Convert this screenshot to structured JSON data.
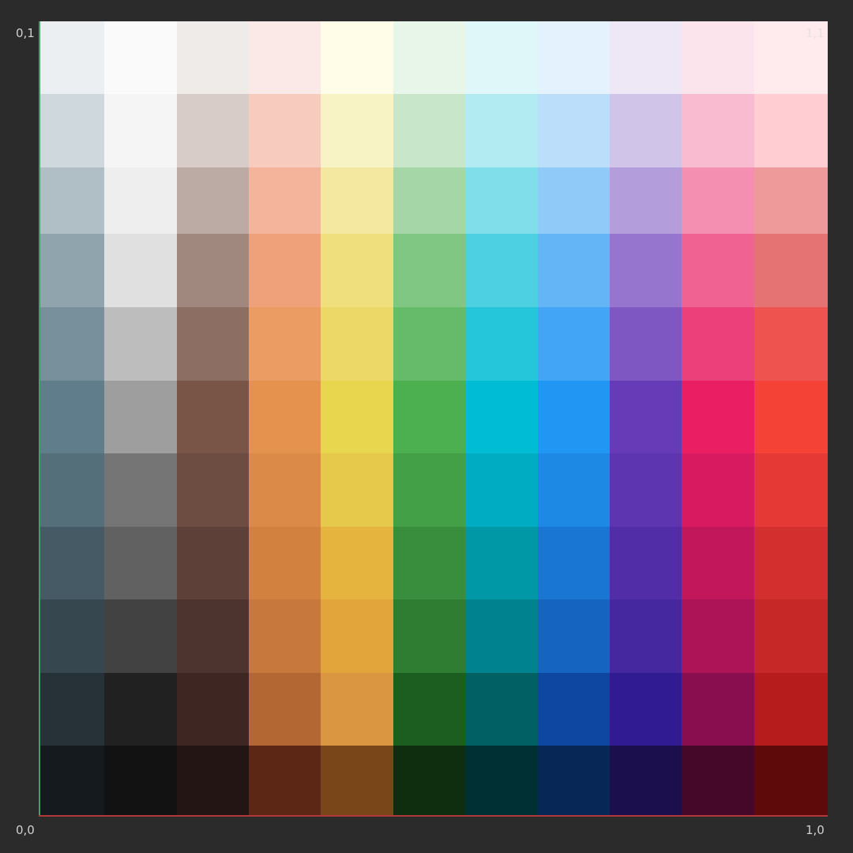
{
  "labels": {
    "top_left": "0,1",
    "top_right": "1,1",
    "bottom_left": "0,0",
    "bottom_right": "1,0"
  },
  "colors": {
    "background": "#2b2b2b",
    "axis_y": "#3fa06a",
    "axis_x": "#b03a3a"
  },
  "palette": [
    [
      "#eceff1",
      "#fafafa",
      "#efebe9",
      "#fbe9e7",
      "#fffde7",
      "#e8f5e9",
      "#e0f7fa",
      "#e3f2fd",
      "#ede7f6",
      "#fce4ec",
      "#ffebee"
    ],
    [
      "#cfd8dc",
      "#f5f5f5",
      "#d7ccc8",
      "#f8cbbf",
      "#f8f3c4",
      "#c8e6c9",
      "#b2ebf2",
      "#bbdefb",
      "#d1c4e9",
      "#f8bbd0",
      "#ffcdd2"
    ],
    [
      "#b0bec5",
      "#eeeeee",
      "#bcaaa4",
      "#f4b39b",
      "#f4e8a0",
      "#a5d6a7",
      "#80deea",
      "#90caf9",
      "#b39ddb",
      "#f48fb1",
      "#ef9a9a"
    ],
    [
      "#90a4ae",
      "#e0e0e0",
      "#a1887f",
      "#efa17a",
      "#f0e07d",
      "#81c784",
      "#4dd0e1",
      "#64b5f6",
      "#9575cd",
      "#f06292",
      "#e57373"
    ],
    [
      "#78909c",
      "#bdbdbd",
      "#8d6e63",
      "#ea9c62",
      "#ecd867",
      "#66bb6a",
      "#26c6da",
      "#42a5f5",
      "#7e57c2",
      "#ec407a",
      "#ef5350"
    ],
    [
      "#607d8b",
      "#9e9e9e",
      "#795548",
      "#e5924e",
      "#e8d64e",
      "#4caf50",
      "#00bcd4",
      "#2196f3",
      "#673ab7",
      "#e91e63",
      "#f44336"
    ],
    [
      "#546e7a",
      "#757575",
      "#6d4c41",
      "#dc8a48",
      "#e6c84a",
      "#43a047",
      "#00acc1",
      "#1e88e5",
      "#5e35b1",
      "#d81b60",
      "#e53935"
    ],
    [
      "#455a64",
      "#616161",
      "#5d4037",
      "#d2813f",
      "#e4b43f",
      "#388e3c",
      "#0097a7",
      "#1976d2",
      "#512da8",
      "#c2185b",
      "#d32f2f"
    ],
    [
      "#37474f",
      "#424242",
      "#4e342e",
      "#c7783d",
      "#e2a53c",
      "#2e7d32",
      "#00838f",
      "#1565c0",
      "#4527a0",
      "#ad1457",
      "#c62828"
    ],
    [
      "#263238",
      "#212121",
      "#3e2723",
      "#b36833",
      "#db9641",
      "#1b5e20",
      "#006064",
      "#0d47a1",
      "#311b92",
      "#880e4f",
      "#b71c1c"
    ],
    [
      "#141a1d",
      "#121212",
      "#221513",
      "#5c2714",
      "#784619",
      "#0f2e10",
      "#003034",
      "#072757",
      "#1c0f4e",
      "#450828",
      "#5f0a0a"
    ]
  ]
}
